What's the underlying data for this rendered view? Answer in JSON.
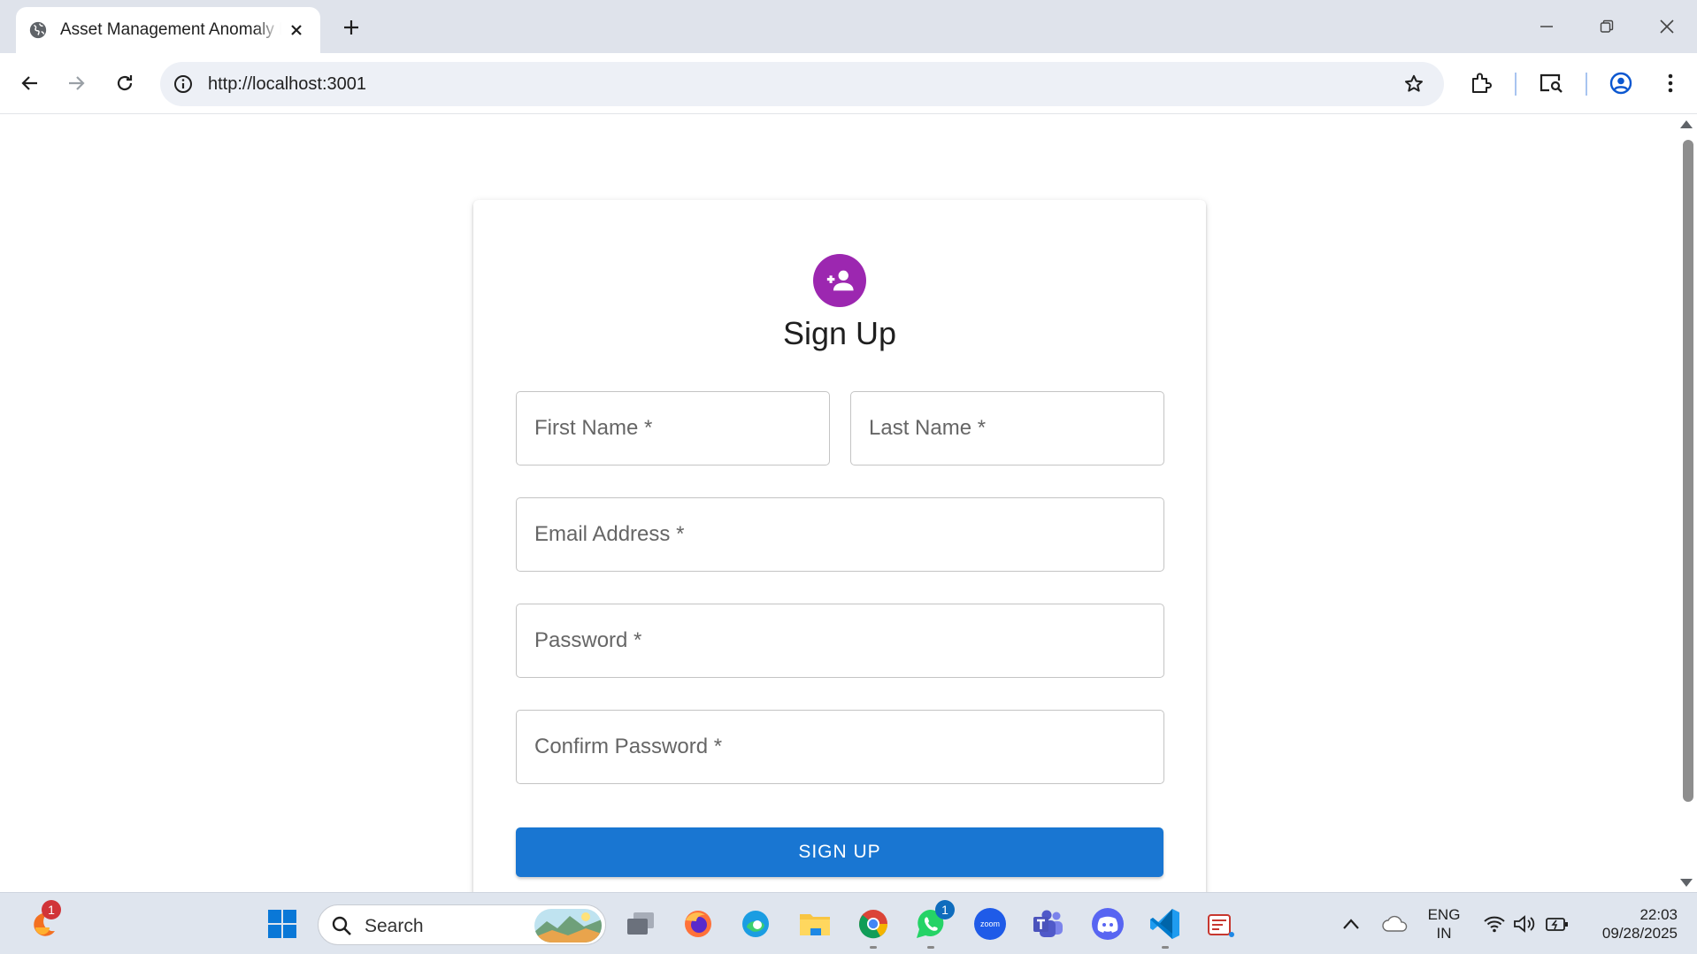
{
  "browser": {
    "tab_title": "Asset Management Anomaly Detection",
    "url": "http://localhost:3001"
  },
  "page": {
    "heading": "Sign Up",
    "fields": {
      "first_name": "First Name *",
      "last_name": "Last Name *",
      "email": "Email Address *",
      "password": "Password *",
      "confirm_password": "Confirm Password *"
    },
    "submit_label": "SIGN UP",
    "colors": {
      "avatar": "#9c27b0",
      "primary": "#1976d2"
    }
  },
  "taskbar": {
    "search_placeholder": "Search",
    "notification_badge": "1",
    "whatsapp_badge": "1",
    "language": "ENG",
    "region": "IN",
    "time": "22:03",
    "date": "09/28/2025",
    "zoom_label": "zoom"
  }
}
